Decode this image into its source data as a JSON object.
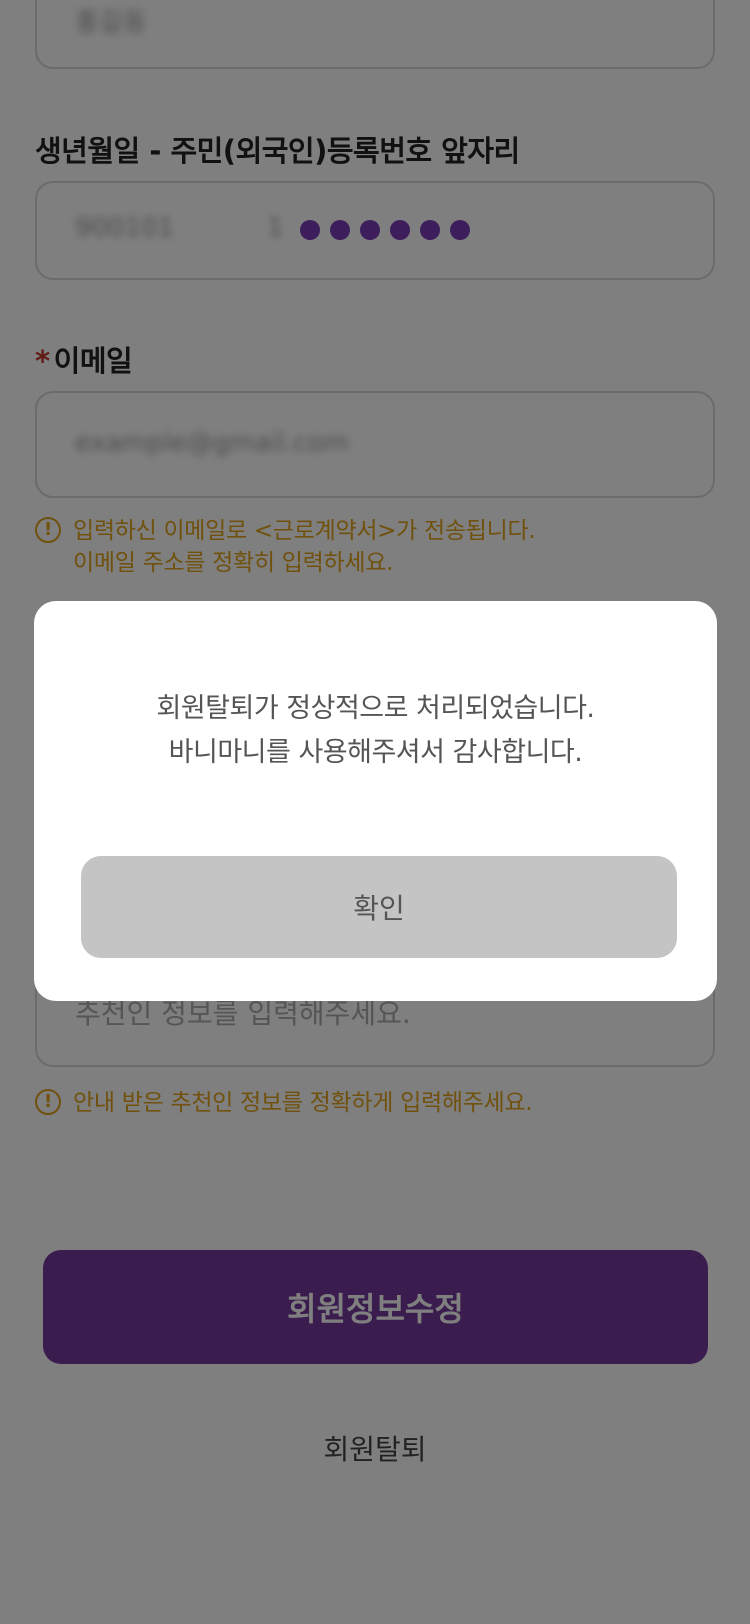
{
  "form": {
    "top_field_value": "홍길동",
    "birth_label": "생년월일 - 주민(외국인)등록번호 앞자리",
    "birth_value": "900101",
    "birth_suffix_value": "1",
    "email_required_mark": "*",
    "email_label": "이메일",
    "email_value": "example@gmail.com",
    "email_hint_line1": "입력하신 이메일로 <근로계약서>가 전송됩니다.",
    "email_hint_line2": "이메일 주소를 정확히 입력하세요.",
    "referrer_placeholder": "추천인 정보를 입력해주세요.",
    "referrer_hint": "안내 받은 추천인 정보를 정확하게 입력해주세요.",
    "hint_icon": "!"
  },
  "actions": {
    "update_label": "회원정보수정",
    "withdraw_label": "회원탈퇴"
  },
  "modal": {
    "message_line1": "회원탈퇴가 정상적으로 처리되었습니다.",
    "message_line2": "바니마니를 사용해주셔서 감사합니다.",
    "confirm_label": "확인"
  },
  "colors": {
    "primary": "#76399e",
    "warning": "#e0a21a",
    "required": "#c0392b",
    "overlay": "rgba(0,0,0,0.5)"
  }
}
